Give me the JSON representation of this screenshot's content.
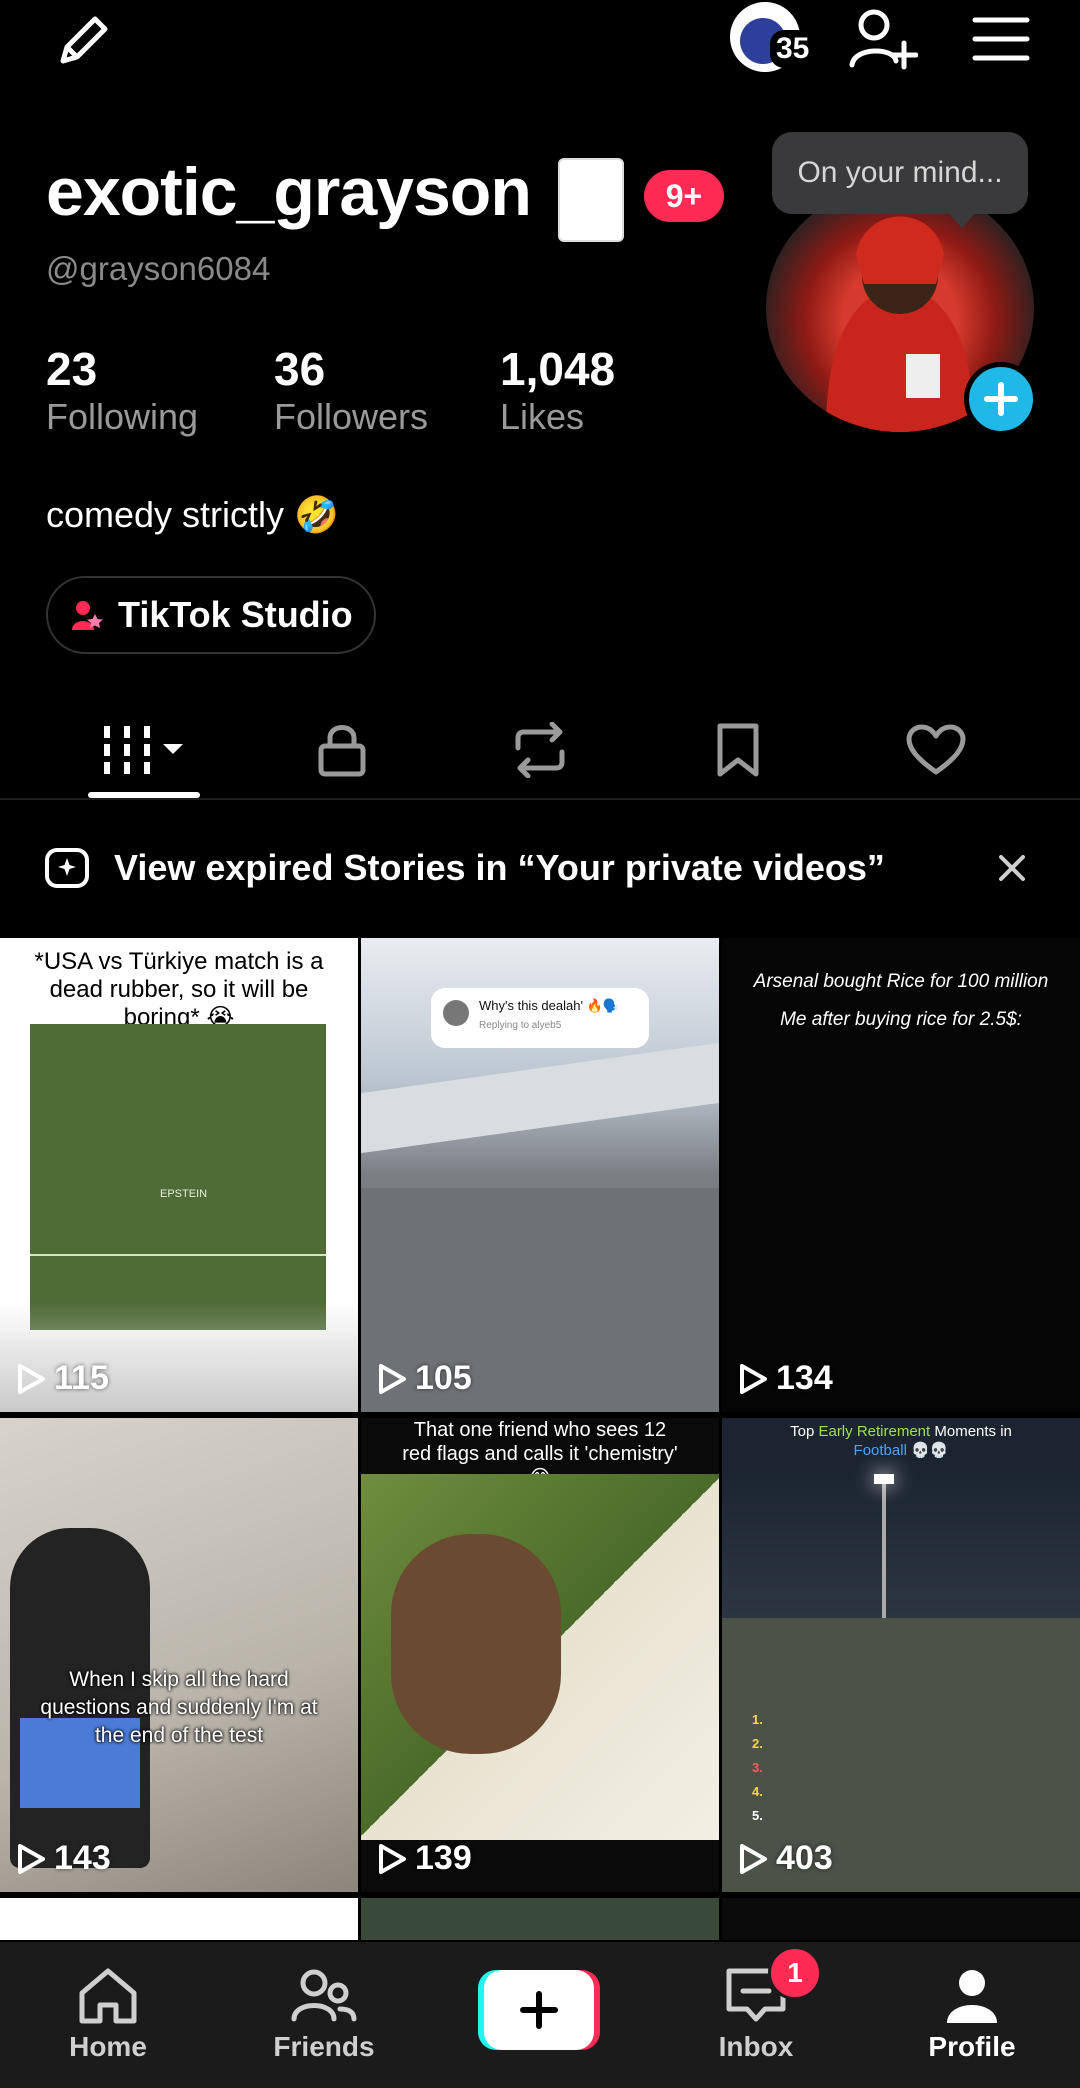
{
  "profile": {
    "display_name": "exotic_grayson",
    "display_emoji": "🃏",
    "notification_badge": "9+",
    "handle": "@grayson6084",
    "stats": [
      {
        "value": "23",
        "label": "Following"
      },
      {
        "value": "36",
        "label": "Followers"
      },
      {
        "value": "1,048",
        "label": "Likes"
      }
    ],
    "bio": "comedy strictly 🤣",
    "studio_button": "TikTok Studio",
    "mind_prompt": "On your mind...",
    "top_avatar_count": "35"
  },
  "banner": {
    "text": "View expired Stories in “Your private videos”"
  },
  "videos": [
    {
      "views": "115",
      "caption": "*USA vs Türkiye match is a dead rubber, so it will be boring* 😭",
      "inner": "EPSTEIN"
    },
    {
      "views": "105",
      "caption": "Why's this dealah' 🔥🗣️",
      "sub": "Replying to alyeb5"
    },
    {
      "views": "134",
      "caption": "Arsenal bought Rice for 100 million",
      "caption2": "Me after buying rice for 2.5$:"
    },
    {
      "views": "143",
      "caption": "When I skip all the hard questions and suddenly I'm at the end of the test"
    },
    {
      "views": "139",
      "caption": "That one friend who sees 12 red flags and calls it 'chemistry' 😂"
    },
    {
      "views": "403",
      "caption_a": "Top ",
      "caption_b": "Early",
      "caption_c": " ",
      "caption_d": "Retirement",
      "caption_e": " Moments in ",
      "caption_f": "Football",
      "caption_g": " 💀💀",
      "list": [
        "1.",
        "2.",
        "3.",
        "4.",
        "5."
      ]
    }
  ],
  "nav": {
    "home": "Home",
    "friends": "Friends",
    "inbox": "Inbox",
    "inbox_badge": "1",
    "profile": "Profile"
  },
  "colors": {
    "accent_pink": "#fe2c55",
    "accent_cyan": "#20b8e6",
    "background": "#000000"
  }
}
